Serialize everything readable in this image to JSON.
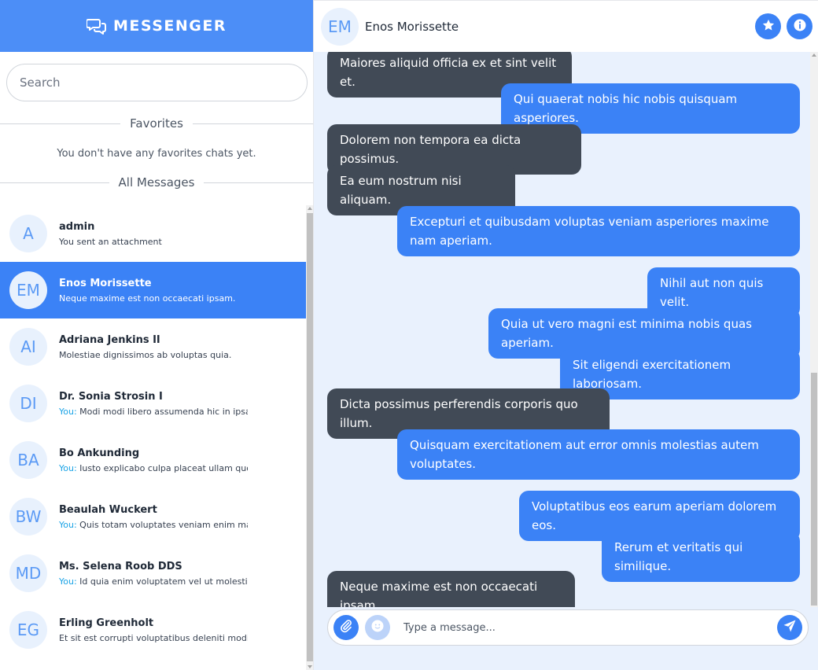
{
  "app": {
    "title": "MESSENGER",
    "logo_icon": "chat-bubbles-icon"
  },
  "search": {
    "placeholder": "Search",
    "value": ""
  },
  "favorites": {
    "heading": "Favorites",
    "empty_text": "You don't have any favorites chats yet."
  },
  "all_messages": {
    "heading": "All Messages"
  },
  "contacts": [
    {
      "initials": "A",
      "name": "admin",
      "you_prefix": "",
      "preview": "You sent an attachment",
      "active": false
    },
    {
      "initials": "EM",
      "name": "Enos Morissette",
      "you_prefix": "",
      "preview": "Neque maxime est non occaecati ipsam.",
      "active": true
    },
    {
      "initials": "AI",
      "name": "Adriana Jenkins II",
      "you_prefix": "",
      "preview": "Molestiae dignissimos ab voluptas quia.",
      "active": false
    },
    {
      "initials": "DI",
      "name": "Dr. Sonia Strosin I",
      "you_prefix": "You:",
      "preview": " Modi modi libero assumenda hic in ipsa",
      "active": false
    },
    {
      "initials": "BA",
      "name": "Bo Ankunding",
      "you_prefix": "You:",
      "preview": " Iusto explicabo culpa placeat ullam quo",
      "active": false
    },
    {
      "initials": "BW",
      "name": "Beaulah Wuckert",
      "you_prefix": "You:",
      "preview": " Quis totam voluptates veniam enim mai",
      "active": false
    },
    {
      "initials": "MD",
      "name": "Ms. Selena Roob DDS",
      "you_prefix": "You:",
      "preview": " Id quia enim voluptatem vel ut molestias",
      "active": false
    },
    {
      "initials": "EG",
      "name": "Erling Greenholt",
      "you_prefix": "",
      "preview": "Et sit est corrupti voluptatibus deleniti modi e",
      "active": false
    }
  ],
  "chat": {
    "avatar_initials": "EM",
    "contact_name": "Enos Morissette",
    "favorite_icon": "star-icon",
    "info_icon": "info-icon"
  },
  "messages": [
    {
      "direction": "in",
      "text": "Maiores aliquid officia ex et sint velit et."
    },
    {
      "direction": "out",
      "text": "Qui quaerat nobis hic nobis quisquam asperiores."
    },
    {
      "direction": "in",
      "text": "Dolorem non tempora ea dicta possimus."
    },
    {
      "direction": "in",
      "text": "Ea eum nostrum nisi aliquam."
    },
    {
      "direction": "out",
      "text": "Excepturi et quibusdam voluptas veniam asperiores maxime nam aperiam."
    },
    {
      "direction": "out",
      "text": "Nihil aut non quis velit."
    },
    {
      "direction": "out",
      "text": "Quia ut vero magni est minima nobis quas aperiam."
    },
    {
      "direction": "out",
      "text": "Sit eligendi exercitationem laboriosam."
    },
    {
      "direction": "in",
      "text": "Dicta possimus perferendis corporis quo illum."
    },
    {
      "direction": "out",
      "text": "Quisquam exercitationem aut error omnis molestias autem voluptates."
    },
    {
      "direction": "out",
      "text": "Voluptatibus eos earum aperiam dolorem eos."
    },
    {
      "direction": "out",
      "text": "Rerum et veritatis qui similique."
    },
    {
      "direction": "in",
      "text": "Neque maxime est non occaecati ipsam."
    }
  ],
  "composer": {
    "placeholder": "Type a message...",
    "value": "",
    "attach_icon": "paperclip-icon",
    "emoji_icon": "emoji-icon",
    "send_icon": "send-icon"
  },
  "colors": {
    "accent": "#3b82f6",
    "header_bg": "#4c8ef7",
    "incoming_bubble": "#414a56",
    "chat_bg": "#e9f1fd",
    "you_prefix": "#19a3e6"
  }
}
